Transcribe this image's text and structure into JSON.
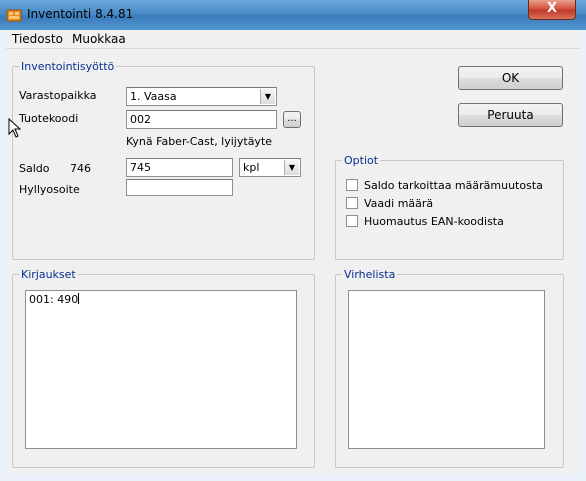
{
  "window": {
    "title": "Inventointi 8.4.81",
    "close_label": "X"
  },
  "menu": {
    "items": [
      "Tiedosto",
      "Muokkaa"
    ]
  },
  "input_group": {
    "legend": "Inventointisyöttö",
    "varastopaikka_label": "Varastopaikka",
    "varastopaikka_value": "1. Vaasa",
    "tuotekoodi_label": "Tuotekoodi",
    "tuotekoodi_value": "002",
    "browse_label": "...",
    "product_name": "Kynä Faber-Cast, lyijytäyte",
    "saldo_label": "Saldo",
    "saldo_current": "746",
    "saldo_value": "745",
    "unit_value": "kpl",
    "hyllyosoite_label": "Hyllyosoite",
    "hyllyosoite_value": ""
  },
  "buttons": {
    "ok_label": "OK",
    "cancel_label": "Peruuta"
  },
  "options_group": {
    "legend": "Optiot",
    "items": [
      {
        "label": "Saldo tarkoittaa määrämuutosta",
        "checked": false
      },
      {
        "label": "Vaadi määrä",
        "checked": false
      },
      {
        "label": "Huomautus EAN-koodista",
        "checked": false
      }
    ]
  },
  "entries_group": {
    "legend": "Kirjaukset",
    "lines": [
      "001: 490"
    ]
  },
  "errors_group": {
    "legend": "Virhelista",
    "lines": []
  }
}
